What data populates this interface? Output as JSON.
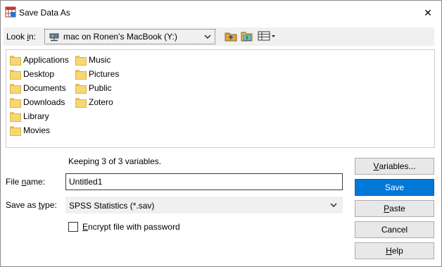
{
  "window": {
    "title": "Save Data As",
    "close_glyph": "✕"
  },
  "lookin": {
    "label_pre": "Look ",
    "label_underline": "i",
    "label_post": "n:",
    "value": "mac on Ronen’s MacBook (Y:)"
  },
  "toolbar": {
    "icons": [
      "up-folder-icon",
      "new-folder-icon",
      "view-menu-icon"
    ]
  },
  "files": {
    "column1": [
      "Applications",
      "Desktop",
      "Documents",
      "Downloads",
      "Library",
      "Movies"
    ],
    "column2": [
      "Music",
      "Pictures",
      "Public",
      "Zotero"
    ]
  },
  "status": {
    "keeping": "Keeping 3 of 3 variables."
  },
  "filename": {
    "label_pre": "File ",
    "label_underline": "n",
    "label_post": "ame:",
    "value": "Untitled1"
  },
  "savetype": {
    "label_pre": "Save as ",
    "label_underline": "t",
    "label_post": "ype:",
    "value": "SPSS Statistics (*.sav)"
  },
  "encrypt": {
    "label_underline": "E",
    "label_post": "ncrypt file with password",
    "checked": false
  },
  "buttons": {
    "variables": {
      "underline": "V",
      "rest": "ariables..."
    },
    "save": {
      "label": "Save"
    },
    "paste": {
      "underline": "P",
      "rest": "aste"
    },
    "cancel": {
      "label": "Cancel"
    },
    "help": {
      "underline": "H",
      "rest": "elp"
    }
  },
  "colors": {
    "accent": "#0078d7",
    "folder": "#f7d774"
  }
}
